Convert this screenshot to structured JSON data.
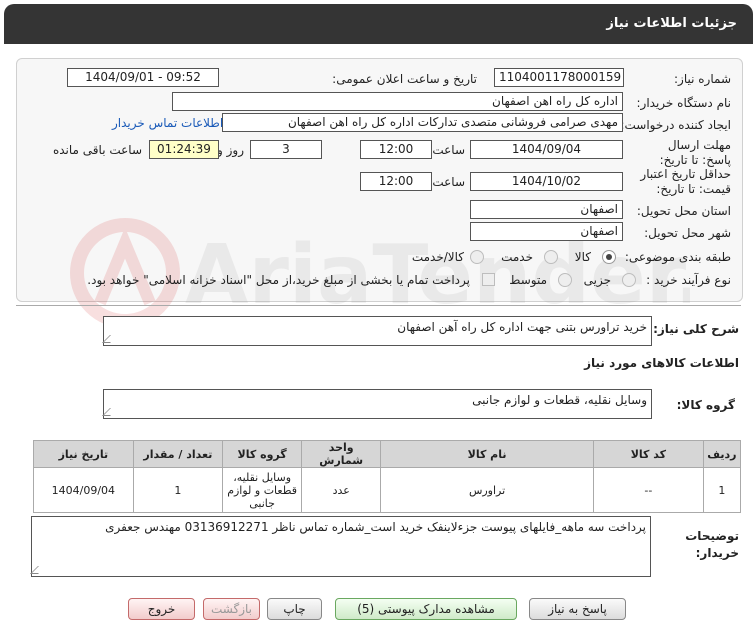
{
  "header": {
    "title": "جزئیات اطلاعات نیاز"
  },
  "watermark": {
    "text": "AriaTender.neT"
  },
  "form": {
    "need_number_label": "شماره نیاز:",
    "need_number": "1104001178000159",
    "announce_label": "تاریخ و ساعت اعلان عمومی:",
    "announce_value": "1404/09/01 - 09:52",
    "buyer_org_label": "نام دستگاه خریدار:",
    "buyer_org": "اداره کل راه اهن اصفهان",
    "creator_label": "ایجاد کننده درخواست:",
    "creator": "مهدی صرامی فروشانی متصدی تدارکات اداره کل راه اهن اصفهان",
    "contact_link": "اطلاعات تماس خریدار",
    "deadline_label": "مهلت ارسال پاسخ: تا تاریخ:",
    "deadline_date": "1404/09/04",
    "time_word": "ساعت",
    "deadline_time": "12:00",
    "days_value": "3",
    "days_word": "روز و",
    "remaining_time": "01:24:39",
    "remaining_label": "ساعت باقی مانده",
    "validity_label": "حداقل تاریخ اعتبار قیمت: تا تاریخ:",
    "validity_date": "1404/10/02",
    "validity_time": "12:00",
    "province_label": "استان محل تحویل:",
    "province": "اصفهان",
    "city_label": "شهر محل تحویل:",
    "city": "اصفهان",
    "category_label": "طبقه بندی موضوعی:",
    "category_options": [
      "کالا",
      "خدمت",
      "کالا/خدمت"
    ],
    "process_label": "نوع فرآیند خرید :",
    "process_options": [
      "جزیی",
      "متوسط"
    ],
    "payment_note": "پرداخت تمام یا بخشی از مبلغ خرید،از محل \"اسناد خزانه اسلامی\" خواهد بود."
  },
  "summary": {
    "label": "شرح کلی نیاز:",
    "value": "خرید تراورس بتنی جهت اداره کل راه آهن اصفهان"
  },
  "goods": {
    "section_title": "اطلاعات کالاهای مورد نیاز",
    "group_label": "گروه کالا:",
    "group_value": "وسایل نقلیه، قطعات و لوازم جانبی"
  },
  "table": {
    "headers": [
      "ردیف",
      "کد کالا",
      "نام کالا",
      "واحد شمارش",
      "گروه کالا",
      "تعداد / مقدار",
      "تاریخ نیاز"
    ],
    "rows": [
      {
        "row": "1",
        "code": "--",
        "name": "تراورس",
        "unit": "عدد",
        "group": "وسایل نقلیه، قطعات و لوازم جانبی",
        "qty": "1",
        "date": "1404/09/04"
      }
    ]
  },
  "notes": {
    "label": "توضیحات خریدار:",
    "value": "پرداخت سه ماهه_فایلهای پیوست جزءلاینفک خرید است_شماره تماس ناظر 03136912271 مهندس جعفری"
  },
  "buttons": {
    "reply": "پاسخ به نیاز",
    "docs": "مشاهده مدارک پیوستی (5)",
    "print": "چاپ",
    "back": "بازگشت",
    "exit": "خروج"
  }
}
